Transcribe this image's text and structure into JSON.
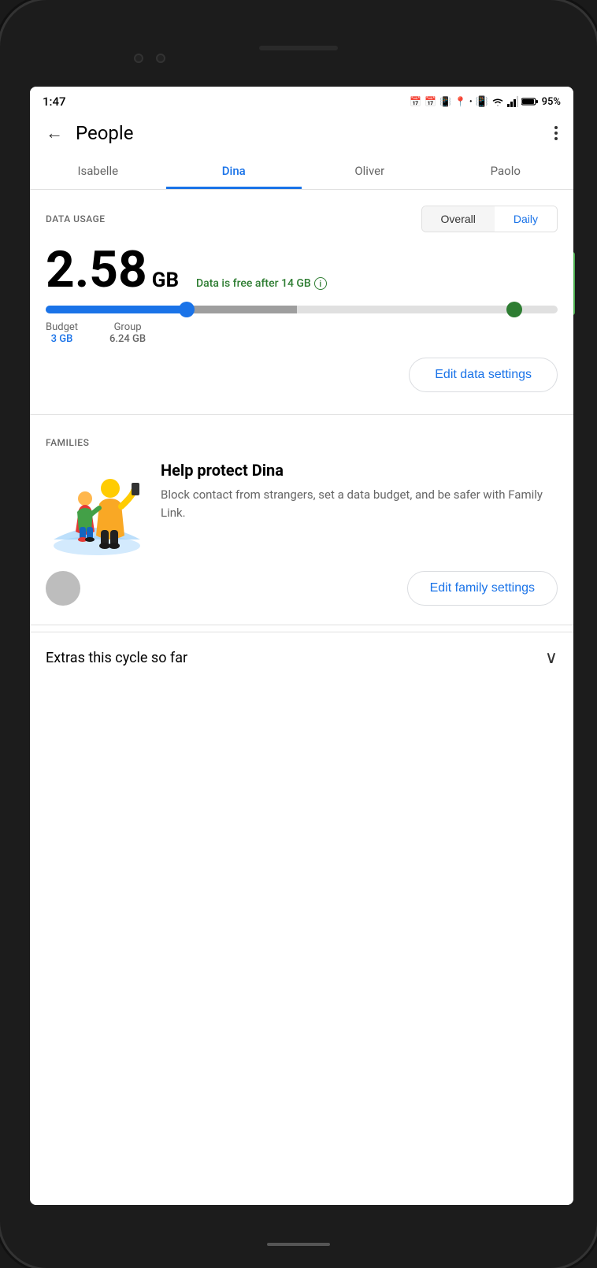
{
  "status_bar": {
    "time": "1:47",
    "battery": "95%",
    "icons": [
      "calendar-31-icon",
      "calendar-31-icon",
      "voicemail-icon",
      "location-icon",
      "dot-icon",
      "vibrate-icon",
      "wifi-icon",
      "signal-icon",
      "battery-icon"
    ]
  },
  "top_bar": {
    "back_label": "←",
    "title": "People",
    "more_label": "⋮"
  },
  "tabs": [
    {
      "label": "Isabelle",
      "active": false
    },
    {
      "label": "Dina",
      "active": true
    },
    {
      "label": "Oliver",
      "active": false
    },
    {
      "label": "Paolo",
      "active": false
    }
  ],
  "data_usage": {
    "section_label": "DATA USAGE",
    "toggle": {
      "overall_label": "Overall",
      "daily_label": "Daily",
      "active": "Daily"
    },
    "amount": "2.58",
    "unit": "GB",
    "free_notice": "Data is free after 14 GB",
    "budget": {
      "label": "Budget",
      "value": "3 GB"
    },
    "group": {
      "label": "Group",
      "value": "6.24 GB"
    },
    "edit_button": "Edit data settings"
  },
  "families": {
    "section_label": "FAMILIES",
    "card": {
      "title": "Help protect Dina",
      "description": "Block contact from strangers, set a data budget, and be safer with Family Link."
    },
    "edit_button": "Edit family settings"
  },
  "extras": {
    "title": "Extras this cycle so far",
    "chevron": "∨"
  }
}
